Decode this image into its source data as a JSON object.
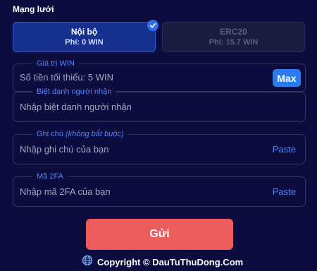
{
  "network": {
    "title": "Mạng lưới",
    "options": [
      {
        "name": "Nội bộ",
        "fee": "Phí: 0 WIN",
        "selected": true
      },
      {
        "name": "ERC20",
        "fee": "Phí: 15.7 WIN",
        "selected": false
      }
    ]
  },
  "fields": {
    "amount": {
      "legend": "Giá trị WIN",
      "placeholder": "Số tiền tối thiểu: 5 WIN",
      "action": "Max"
    },
    "nickname": {
      "legend": "Biệt danh người nhận",
      "placeholder": "Nhập biệt danh người nhận"
    },
    "note": {
      "legend": "Ghi chú",
      "legend_optional": "(không bắt buộc)",
      "placeholder": "Nhập ghi chú của bạn",
      "action": "Paste"
    },
    "twofa": {
      "legend": "Mã 2FA",
      "placeholder": "Nhập mã 2FA của bạn",
      "action": "Paste"
    }
  },
  "submit_label": "Gửi",
  "footer": {
    "copyright": "Copyright © DauTuThuDong.Com",
    "icon": "globe-icon"
  },
  "colors": {
    "background": "#0c0c3f",
    "accent": "#4f86f7",
    "selected_card": "#15308f",
    "submit": "#ec5c5c",
    "max_button": "#2a7bf0"
  }
}
